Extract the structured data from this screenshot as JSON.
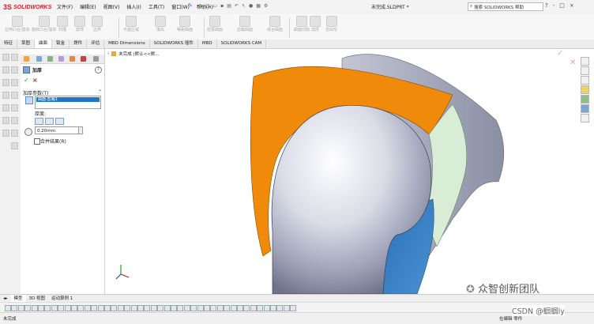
{
  "app": {
    "logo_ds": "3S",
    "logo_text": "SOLIDWORKS",
    "menus": [
      "文件(F)",
      "编辑(E)",
      "视图(V)",
      "插入(I)",
      "工具(T)",
      "窗口(W)",
      "帮助(H)"
    ],
    "doc_title": "未完成.SLDPRT *",
    "search_placeholder": "搜索 SOLIDWORKS 帮助",
    "window_buttons": [
      "?",
      "-",
      "□",
      "×"
    ]
  },
  "ribbon": {
    "groups": [
      "拉伸凸台/基体",
      "旋转凸台/基体",
      "扫描",
      "放样",
      "边界",
      "平面区域",
      "填充",
      "等距曲面",
      "延展曲面",
      "剪裁曲面",
      "缝合曲面",
      "曲面切除",
      "加厚",
      "自由形"
    ]
  },
  "tabs": [
    "特征",
    "草图",
    "曲面",
    "钣金",
    "焊件",
    "评估",
    "MBD Dimensions",
    "SOLIDWORKS 插件",
    "MBD",
    "SOLIDWORKS CAM"
  ],
  "active_tab": "曲面",
  "property_manager": {
    "title": "加厚",
    "group_header": "加厚参数(T)",
    "face_item": "曲面-剪裁1",
    "thickness_label": "厚度:",
    "thickness_value": "0.20mm",
    "merge_label": "合并结果(R)"
  },
  "viewport": {
    "tree_label": "未完成 (默认<<默..."
  },
  "bottom_tabs": [
    "模型",
    "3D 视图",
    "运动算例 1"
  ],
  "bottom_tabs_active": "模型",
  "status": {
    "left": "未完成",
    "right": "在编辑 零件"
  },
  "watermarks": {
    "line1": "众智创新团队",
    "line2": "CSDN @蝈蝈ly"
  },
  "colors": {
    "orange_surface": "#f08a0b",
    "light_green_surface": "#d8ecd6",
    "blue_surface": "#3b84c8",
    "grey_body": "#8d92a6",
    "selection_blue": "#1e75c9"
  }
}
